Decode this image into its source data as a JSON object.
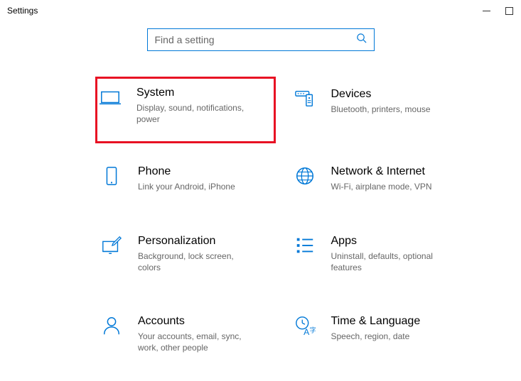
{
  "window": {
    "title": "Settings"
  },
  "search": {
    "placeholder": "Find a setting"
  },
  "tiles": {
    "system": {
      "title": "System",
      "desc": "Display, sound, notifications, power"
    },
    "devices": {
      "title": "Devices",
      "desc": "Bluetooth, printers, mouse"
    },
    "phone": {
      "title": "Phone",
      "desc": "Link your Android, iPhone"
    },
    "network": {
      "title": "Network & Internet",
      "desc": "Wi-Fi, airplane mode, VPN"
    },
    "personalization": {
      "title": "Personalization",
      "desc": "Background, lock screen, colors"
    },
    "apps": {
      "title": "Apps",
      "desc": "Uninstall, defaults, optional features"
    },
    "accounts": {
      "title": "Accounts",
      "desc": "Your accounts, email, sync, work, other people"
    },
    "timelang": {
      "title": "Time & Language",
      "desc": "Speech, region, date"
    }
  },
  "colors": {
    "accent": "#0078D7",
    "highlight": "#E81123"
  }
}
